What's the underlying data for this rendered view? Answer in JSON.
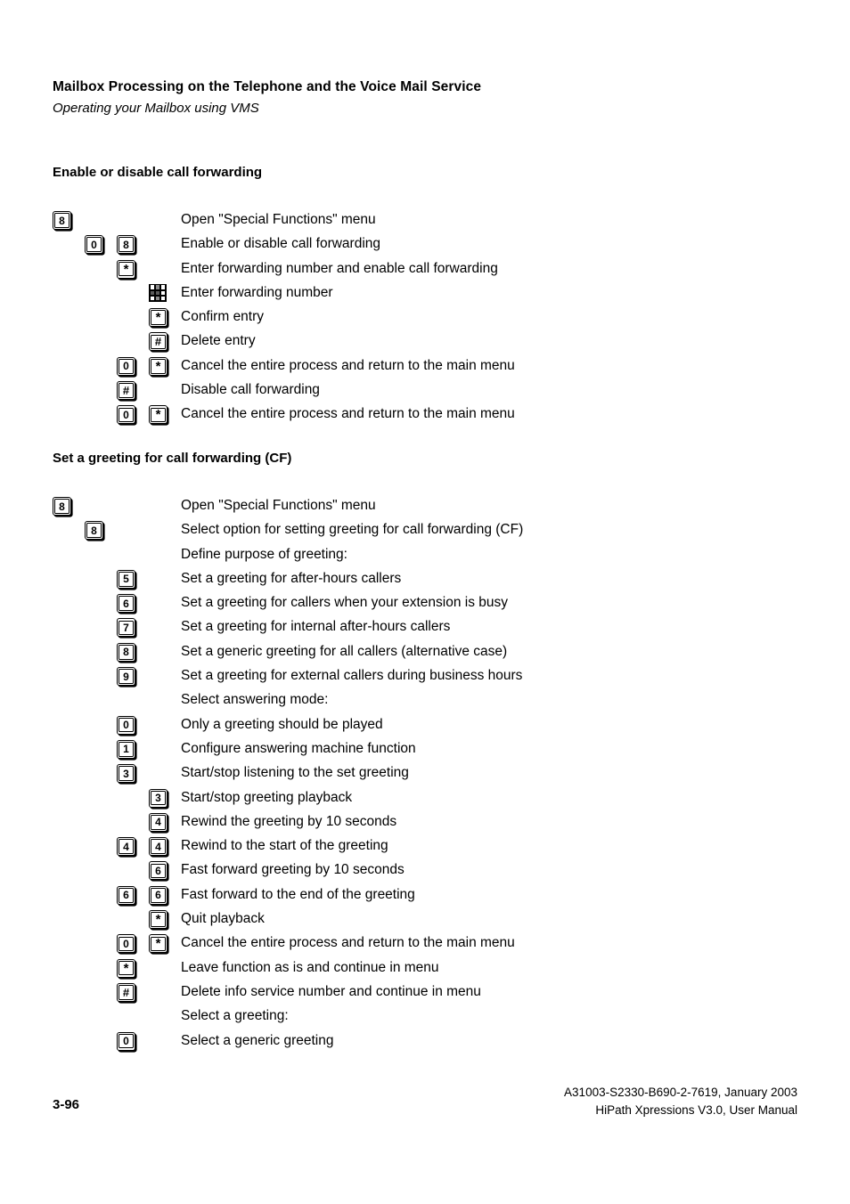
{
  "header": {
    "title": "Mailbox Processing on the Telephone and the Voice Mail Service",
    "subtitle": "Operating your Mailbox using VMS"
  },
  "sections": [
    {
      "heading": "Enable or disable call forwarding",
      "rows": [
        {
          "keys": [
            {
              "col": 0,
              "type": "key",
              "glyph": "8"
            }
          ],
          "text": "Open \"Special Functions\" menu"
        },
        {
          "keys": [
            {
              "col": 1,
              "type": "key",
              "glyph": "0"
            },
            {
              "col": 2,
              "type": "key",
              "glyph": "8"
            }
          ],
          "text": "Enable or disable call forwarding"
        },
        {
          "keys": [
            {
              "col": 2,
              "type": "key",
              "glyph": "*"
            }
          ],
          "text": "Enter forwarding number and enable call forwarding"
        },
        {
          "keys": [
            {
              "col": 3,
              "type": "keypad"
            }
          ],
          "text": "Enter forwarding number"
        },
        {
          "keys": [
            {
              "col": 3,
              "type": "key",
              "glyph": "*"
            }
          ],
          "text": "Confirm entry"
        },
        {
          "keys": [
            {
              "col": 3,
              "type": "key",
              "glyph": "#"
            }
          ],
          "text": "Delete entry"
        },
        {
          "keys": [
            {
              "col": 2,
              "type": "key",
              "glyph": "0"
            },
            {
              "col": 3,
              "type": "key",
              "glyph": "*"
            }
          ],
          "text": "Cancel the entire process and return to the main menu"
        },
        {
          "keys": [
            {
              "col": 2,
              "type": "key",
              "glyph": "#"
            }
          ],
          "text": "Disable call forwarding"
        },
        {
          "keys": [
            {
              "col": 2,
              "type": "key",
              "glyph": "0"
            },
            {
              "col": 3,
              "type": "key",
              "glyph": "*"
            }
          ],
          "text": "Cancel the entire process and return to the main menu"
        }
      ]
    },
    {
      "heading": "Set a greeting for call forwarding (CF)",
      "rows": [
        {
          "keys": [
            {
              "col": 0,
              "type": "key",
              "glyph": "8"
            }
          ],
          "text": "Open \"Special Functions\" menu"
        },
        {
          "keys": [
            {
              "col": 1,
              "type": "key",
              "glyph": "8"
            }
          ],
          "text": "Select option for setting greeting for call forwarding (CF)"
        },
        {
          "keys": [],
          "text": "Define purpose of greeting:"
        },
        {
          "keys": [
            {
              "col": 2,
              "type": "key",
              "glyph": "5"
            }
          ],
          "text": "Set a greeting for after-hours callers"
        },
        {
          "keys": [
            {
              "col": 2,
              "type": "key",
              "glyph": "6"
            }
          ],
          "text": "Set a greeting for callers when your extension is busy"
        },
        {
          "keys": [
            {
              "col": 2,
              "type": "key",
              "glyph": "7"
            }
          ],
          "text": "Set a greeting for internal after-hours callers"
        },
        {
          "keys": [
            {
              "col": 2,
              "type": "key",
              "glyph": "8"
            }
          ],
          "text": "Set a generic greeting for all callers (alternative case)"
        },
        {
          "keys": [
            {
              "col": 2,
              "type": "key",
              "glyph": "9"
            }
          ],
          "text": "Set a greeting for external callers during business hours"
        },
        {
          "keys": [],
          "text": "Select answering mode:"
        },
        {
          "keys": [
            {
              "col": 2,
              "type": "key",
              "glyph": "0"
            }
          ],
          "text": "Only a greeting should be played"
        },
        {
          "keys": [
            {
              "col": 2,
              "type": "key",
              "glyph": "1"
            }
          ],
          "text": "Configure answering machine function"
        },
        {
          "keys": [
            {
              "col": 2,
              "type": "key",
              "glyph": "3"
            }
          ],
          "text": "Start/stop listening to the set greeting"
        },
        {
          "keys": [
            {
              "col": 3,
              "type": "key",
              "glyph": "3"
            }
          ],
          "text": "Start/stop greeting playback"
        },
        {
          "keys": [
            {
              "col": 3,
              "type": "key",
              "glyph": "4"
            }
          ],
          "text": "Rewind the greeting by 10 seconds"
        },
        {
          "keys": [
            {
              "col": 2,
              "type": "key",
              "glyph": "4"
            },
            {
              "col": 3,
              "type": "key",
              "glyph": "4"
            }
          ],
          "text": "Rewind to the start of the greeting"
        },
        {
          "keys": [
            {
              "col": 3,
              "type": "key",
              "glyph": "6"
            }
          ],
          "text": "Fast forward greeting by 10 seconds"
        },
        {
          "keys": [
            {
              "col": 2,
              "type": "key",
              "glyph": "6"
            },
            {
              "col": 3,
              "type": "key",
              "glyph": "6"
            }
          ],
          "text": "Fast forward to the end of the greeting"
        },
        {
          "keys": [
            {
              "col": 3,
              "type": "key",
              "glyph": "*"
            }
          ],
          "text": "Quit playback"
        },
        {
          "keys": [
            {
              "col": 2,
              "type": "key",
              "glyph": "0"
            },
            {
              "col": 3,
              "type": "key",
              "glyph": "*"
            }
          ],
          "text": "Cancel the entire process and return to the main menu"
        },
        {
          "keys": [
            {
              "col": 2,
              "type": "key",
              "glyph": "*"
            }
          ],
          "text": "Leave function as is and continue in menu"
        },
        {
          "keys": [
            {
              "col": 2,
              "type": "key",
              "glyph": "#"
            }
          ],
          "text": "Delete info service number and continue in menu"
        },
        {
          "keys": [],
          "text": "Select a greeting:"
        },
        {
          "keys": [
            {
              "col": 2,
              "type": "key",
              "glyph": "0"
            }
          ],
          "text": "Select a generic greeting"
        }
      ]
    }
  ],
  "footer": {
    "page_number": "3-96",
    "doc_id": "A31003-S2330-B690-2-7619, January 2003",
    "product": "HiPath Xpressions V3.0, User Manual"
  }
}
